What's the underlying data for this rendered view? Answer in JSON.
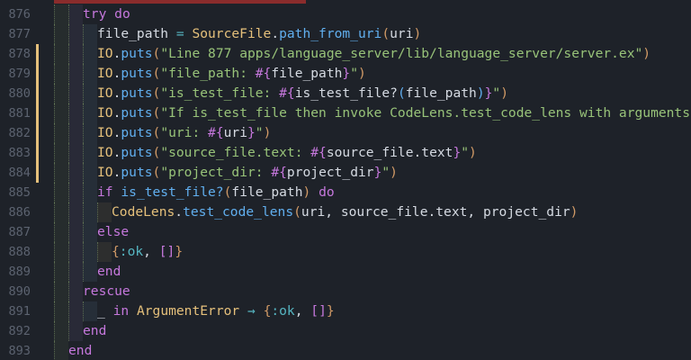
{
  "colors": {
    "background": "#1e2229",
    "keyword": "#c678dd",
    "module": "#e5c07b",
    "function": "#61afef",
    "string": "#98c379",
    "line_number": "#5c6370",
    "git_modified": "#e5c07b"
  },
  "lines": [
    {
      "num": "876",
      "indent": 2,
      "changed": false,
      "tokens": [
        {
          "t": "try",
          "c": "kw"
        },
        {
          "t": " "
        },
        {
          "t": "do",
          "c": "kw"
        }
      ]
    },
    {
      "num": "877",
      "indent": 3,
      "changed": false,
      "tokens": [
        {
          "t": "file_path"
        },
        {
          "t": " = ",
          "c": "op"
        },
        {
          "t": "SourceFile",
          "c": "mod"
        },
        {
          "t": "."
        },
        {
          "t": "path_from_uri",
          "c": "fn"
        },
        {
          "t": "(",
          "c": "br1"
        },
        {
          "t": "uri"
        },
        {
          "t": ")",
          "c": "br1"
        }
      ]
    },
    {
      "num": "878",
      "indent": 3,
      "changed": true,
      "tokens": [
        {
          "t": "IO",
          "c": "mod"
        },
        {
          "t": "."
        },
        {
          "t": "puts",
          "c": "fn"
        },
        {
          "t": "(",
          "c": "br1"
        },
        {
          "t": "\"Line 877 apps/language_server/lib/language_server/server.ex\"",
          "c": "str"
        },
        {
          "t": ")",
          "c": "br1"
        }
      ]
    },
    {
      "num": "879",
      "indent": 3,
      "changed": true,
      "tokens": [
        {
          "t": "IO",
          "c": "mod"
        },
        {
          "t": "."
        },
        {
          "t": "puts",
          "c": "fn"
        },
        {
          "t": "(",
          "c": "br1"
        },
        {
          "t": "\"file_path: ",
          "c": "str"
        },
        {
          "t": "#{",
          "c": "interp"
        },
        {
          "t": "file_path"
        },
        {
          "t": "}",
          "c": "interp"
        },
        {
          "t": "\"",
          "c": "str"
        },
        {
          "t": ")",
          "c": "br1"
        }
      ]
    },
    {
      "num": "880",
      "indent": 3,
      "changed": true,
      "tokens": [
        {
          "t": "IO",
          "c": "mod"
        },
        {
          "t": "."
        },
        {
          "t": "puts",
          "c": "fn"
        },
        {
          "t": "(",
          "c": "br1"
        },
        {
          "t": "\"is_test_file: ",
          "c": "str"
        },
        {
          "t": "#{",
          "c": "interp"
        },
        {
          "t": "is_test_file?"
        },
        {
          "t": "(",
          "c": "br3"
        },
        {
          "t": "file_path"
        },
        {
          "t": ")",
          "c": "br3"
        },
        {
          "t": "}",
          "c": "interp"
        },
        {
          "t": "\"",
          "c": "str"
        },
        {
          "t": ")",
          "c": "br1"
        }
      ]
    },
    {
      "num": "881",
      "indent": 3,
      "changed": true,
      "tokens": [
        {
          "t": "IO",
          "c": "mod"
        },
        {
          "t": "."
        },
        {
          "t": "puts",
          "c": "fn"
        },
        {
          "t": "(",
          "c": "br1"
        },
        {
          "t": "\"If is_test_file then invoke CodeLens.test_code_lens with arguments\"",
          "c": "str"
        },
        {
          "t": ")",
          "c": "br1"
        }
      ]
    },
    {
      "num": "882",
      "indent": 3,
      "changed": true,
      "tokens": [
        {
          "t": "IO",
          "c": "mod"
        },
        {
          "t": "."
        },
        {
          "t": "puts",
          "c": "fn"
        },
        {
          "t": "(",
          "c": "br1"
        },
        {
          "t": "\"uri: ",
          "c": "str"
        },
        {
          "t": "#{",
          "c": "interp"
        },
        {
          "t": "uri"
        },
        {
          "t": "}",
          "c": "interp"
        },
        {
          "t": "\"",
          "c": "str"
        },
        {
          "t": ")",
          "c": "br1"
        }
      ]
    },
    {
      "num": "883",
      "indent": 3,
      "changed": true,
      "tokens": [
        {
          "t": "IO",
          "c": "mod"
        },
        {
          "t": "."
        },
        {
          "t": "puts",
          "c": "fn"
        },
        {
          "t": "(",
          "c": "br1"
        },
        {
          "t": "\"source_file.text: ",
          "c": "str"
        },
        {
          "t": "#{",
          "c": "interp"
        },
        {
          "t": "source_file.text"
        },
        {
          "t": "}",
          "c": "interp"
        },
        {
          "t": "\"",
          "c": "str"
        },
        {
          "t": ")",
          "c": "br1"
        }
      ]
    },
    {
      "num": "884",
      "indent": 3,
      "changed": true,
      "tokens": [
        {
          "t": "IO",
          "c": "mod"
        },
        {
          "t": "."
        },
        {
          "t": "puts",
          "c": "fn"
        },
        {
          "t": "(",
          "c": "br1"
        },
        {
          "t": "\"project_dir: ",
          "c": "str"
        },
        {
          "t": "#{",
          "c": "interp"
        },
        {
          "t": "project_dir"
        },
        {
          "t": "}",
          "c": "interp"
        },
        {
          "t": "\"",
          "c": "str"
        },
        {
          "t": ")",
          "c": "br1"
        }
      ]
    },
    {
      "num": "885",
      "indent": 3,
      "changed": false,
      "tokens": [
        {
          "t": "if",
          "c": "kw"
        },
        {
          "t": " "
        },
        {
          "t": "is_test_file?",
          "c": "fn"
        },
        {
          "t": "(",
          "c": "br1"
        },
        {
          "t": "file_path"
        },
        {
          "t": ")",
          "c": "br1"
        },
        {
          "t": " "
        },
        {
          "t": "do",
          "c": "kw"
        }
      ]
    },
    {
      "num": "886",
      "indent": 4,
      "changed": false,
      "tokens": [
        {
          "t": "CodeLens",
          "c": "mod"
        },
        {
          "t": "."
        },
        {
          "t": "test_code_lens",
          "c": "fn"
        },
        {
          "t": "(",
          "c": "br1"
        },
        {
          "t": "uri, source_file.text, project_dir"
        },
        {
          "t": ")",
          "c": "br1"
        }
      ]
    },
    {
      "num": "887",
      "indent": 3,
      "changed": false,
      "tokens": [
        {
          "t": "else",
          "c": "kw"
        }
      ]
    },
    {
      "num": "888",
      "indent": 4,
      "changed": false,
      "tokens": [
        {
          "t": "{",
          "c": "br1"
        },
        {
          "t": ":ok",
          "c": "sym"
        },
        {
          "t": ", "
        },
        {
          "t": "[]",
          "c": "br2"
        },
        {
          "t": "}",
          "c": "br1"
        }
      ]
    },
    {
      "num": "889",
      "indent": 3,
      "changed": false,
      "tokens": [
        {
          "t": "end",
          "c": "kw"
        }
      ]
    },
    {
      "num": "890",
      "indent": 2,
      "changed": false,
      "tokens": [
        {
          "t": "rescue",
          "c": "kw"
        }
      ]
    },
    {
      "num": "891",
      "indent": 3,
      "changed": false,
      "tokens": [
        {
          "t": "_"
        },
        {
          "t": " "
        },
        {
          "t": "in",
          "c": "kw"
        },
        {
          "t": " "
        },
        {
          "t": "ArgumentError",
          "c": "mod"
        },
        {
          "t": " → ",
          "c": "op"
        },
        {
          "t": "{",
          "c": "br1"
        },
        {
          "t": ":ok",
          "c": "sym"
        },
        {
          "t": ", "
        },
        {
          "t": "[]",
          "c": "br2"
        },
        {
          "t": "}",
          "c": "br1"
        }
      ]
    },
    {
      "num": "892",
      "indent": 2,
      "changed": false,
      "tokens": [
        {
          "t": "end",
          "c": "kw"
        }
      ]
    },
    {
      "num": "893",
      "indent": 1,
      "changed": false,
      "tokens": [
        {
          "t": "end",
          "c": "kw"
        }
      ]
    }
  ]
}
